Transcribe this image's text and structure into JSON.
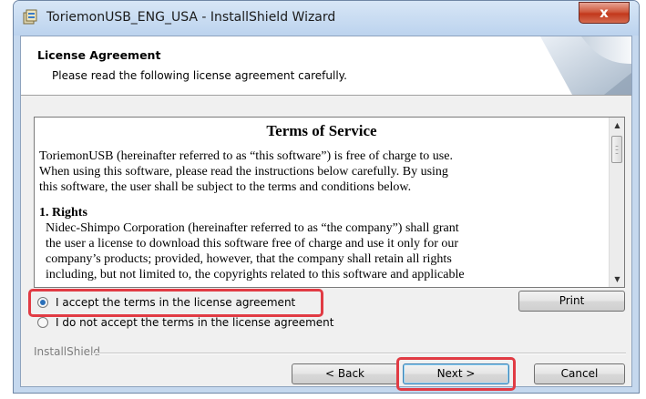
{
  "window": {
    "title": "ToriemonUSB_ENG_USA - InstallShield Wizard",
    "close_label": "x"
  },
  "header": {
    "title": "License Agreement",
    "subtitle": "Please read the following license agreement carefully."
  },
  "license": {
    "heading": "Terms of Service",
    "paragraph1": [
      "ToriemonUSB (hereinafter referred to as “this software”) is free of charge to use.",
      "When using this software, please read the instructions below carefully.  By using",
      "this software, the user shall be subject to the terms and conditions below."
    ],
    "section1_title": "1. Rights",
    "section1_lines": [
      "Nidec-Shimpo Corporation (hereinafter referred to as “the company”) shall grant",
      "the user a license to download this software free of charge and use it only for our",
      "company’s products; provided, however, that the company shall retain all rights",
      "including, but not limited to, the copyrights related to this software and applicable"
    ]
  },
  "options": {
    "accept_label": "I accept the terms in the license agreement",
    "decline_label": "I do not accept the terms in the license agreement",
    "selected": "accept"
  },
  "buttons": {
    "print": "Print",
    "back": "< Back",
    "next": "Next >",
    "cancel": "Cancel"
  },
  "footer": {
    "brand": "InstallShield"
  },
  "colors": {
    "highlight": "#e13b44",
    "title_bar": "#c5d8ee",
    "close_button": "#c2381c"
  }
}
